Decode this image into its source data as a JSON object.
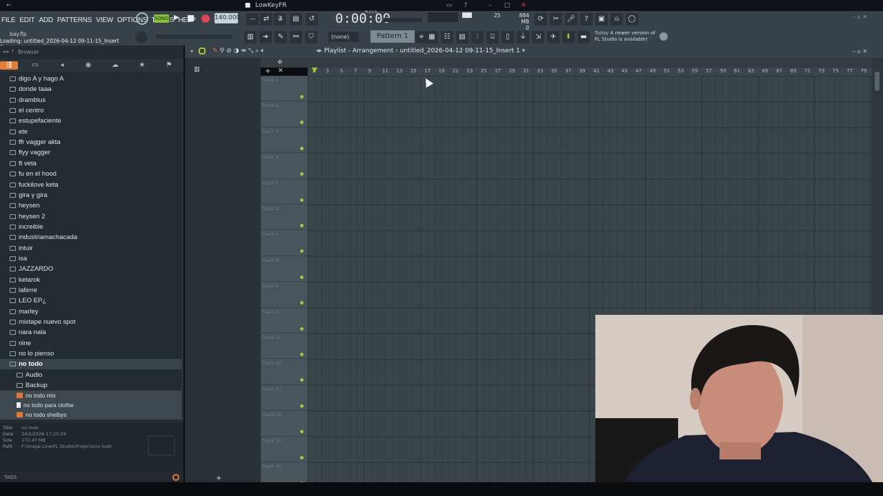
{
  "window": {
    "title": "LowKeyFR"
  },
  "menu": [
    "FILE",
    "EDIT",
    "ADD",
    "PATTERNS",
    "VIEW",
    "OPTIONS",
    "TOOLS",
    "HELP"
  ],
  "transport": {
    "song_label": "SONG",
    "tempo": "140.000",
    "time": "0:00:00",
    "time_unit": "M:S:CS",
    "cpu": "25",
    "memory": "884 MB",
    "mem_sub": "0"
  },
  "pattern": {
    "selector": "(none)",
    "current": "Pattern 1"
  },
  "news": {
    "line1": "Today",
    "line1b": "A newer version of",
    "line2": "FL Studio is available!"
  },
  "hint": {
    "file": "bay.flp",
    "loading": "Loading: untitled_2026-04-12 09-11-15_Insert 1.wav"
  },
  "browser": {
    "title": "Browser",
    "folders": [
      "digo A y hago A",
      "donde taaa",
      "dramblus",
      "el centro",
      "estupefaciente",
      "ete",
      "ffr vagger akta",
      "flyy vagger",
      "ft veta",
      "fu en el hood",
      "fuckilove keta",
      "gira y gira",
      "heysen",
      "heysen 2",
      "increible",
      "industriamachacada",
      "intuir",
      "isa",
      "JAZZARDO",
      "ketarok",
      "laferre",
      "LEO EP¿",
      "marley",
      "mixtape nuevo spot",
      "nara nala",
      "nine",
      "no lo pienso"
    ],
    "selected_folder": "no todo",
    "subfolders": [
      "Audio",
      "Backup"
    ],
    "files": [
      "no todo mix",
      "no todo para clothe",
      "no todo shelbys"
    ],
    "info": {
      "title_label": "Title",
      "title": "no todo",
      "date_label": "Date",
      "date": "24/2/2026 17:20:24",
      "size_label": "Size",
      "size": "172.47 MB",
      "path_label": "Path",
      "path": "F:\\Image-Line\\FL Studio\\Projects\\no todo"
    },
    "tags_label": "TAGS"
  },
  "playlist": {
    "title": "Playlist - Arrangement",
    "arrangement": "untitled_2026-04-12 09-11-15_Insert 1",
    "ruler": [
      "1",
      "3",
      "5",
      "7",
      "9",
      "11",
      "13",
      "15",
      "17",
      "19",
      "21",
      "23",
      "25",
      "27",
      "29",
      "31",
      "33",
      "35",
      "37",
      "39",
      "41",
      "43",
      "45",
      "47",
      "49",
      "51",
      "53",
      "55",
      "57",
      "59",
      "61",
      "63",
      "65",
      "67",
      "69",
      "71",
      "73",
      "75",
      "77",
      "79"
    ],
    "tracks": [
      "Track 1",
      "Track 2",
      "Track 3",
      "Track 4",
      "Track 5",
      "Track 6",
      "Track 7",
      "Track 8",
      "Track 9",
      "Track 10",
      "Track 11",
      "Track 12",
      "Track 13",
      "Track 14",
      "Track 15",
      "Track 16"
    ]
  },
  "colors": {
    "accent": "#e0803a",
    "green": "#9ccc3a",
    "record": "#e0455a"
  }
}
